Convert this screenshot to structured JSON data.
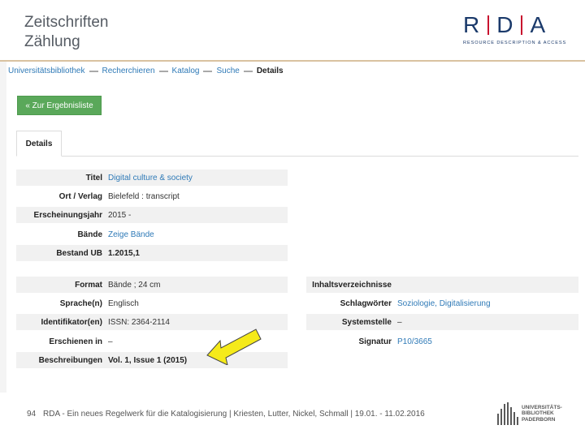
{
  "slide": {
    "title_line1": "Zeitschriften",
    "title_line2": "Zählung",
    "footer_page": "94",
    "footer_text": "RDA - Ein neues Regelwerk für die Katalogisierung | Kriesten, Lutter, Nickel, Schmall | 19.01. - 11.02.2016"
  },
  "rda_logo": {
    "letters": [
      "R",
      "D",
      "A"
    ],
    "tagline": "RESOURCE DESCRIPTION & ACCESS",
    "colors": {
      "letters": "#1b3a6b",
      "bars": "#c8102e"
    }
  },
  "ub_logo": {
    "line1": "UNIVERSITÄTS-",
    "line2": "BIBLIOTHEK",
    "line3": "PADERBORN"
  },
  "breadcrumb": {
    "items": [
      "Universitätsbibliothek",
      "Recherchieren",
      "Katalog",
      "Suche"
    ],
    "current": "Details"
  },
  "back_button": {
    "label": "« Zur Ergebnisliste",
    "color": "#5aa85a"
  },
  "tabs": [
    {
      "label": "Details",
      "active": true
    }
  ],
  "details_top": [
    {
      "label": "Titel",
      "value": "Digital culture & society",
      "style": "link"
    },
    {
      "label": "Ort / Verlag",
      "value": "Bielefeld : transcript",
      "style": "plain"
    },
    {
      "label": "Erscheinungsjahr",
      "value": "2015 -",
      "style": "plain"
    },
    {
      "label": "Bände",
      "value": "Zeige Bände",
      "style": "link"
    },
    {
      "label": "Bestand UB",
      "value": "1.2015,1",
      "style": "bold"
    }
  ],
  "details_left": [
    {
      "label": "Format",
      "value": "Bände ; 24 cm",
      "style": "plain"
    },
    {
      "label": "Sprache(n)",
      "value": "Englisch",
      "style": "plain"
    },
    {
      "label": "Identifikator(en)",
      "value": "ISSN: 2364-2114",
      "style": "plain"
    },
    {
      "label": "Erschienen in",
      "value": "–",
      "style": "plain"
    },
    {
      "label": "Beschreibungen",
      "value": "Vol. 1, Issue 1 (2015)",
      "style": "bold"
    }
  ],
  "details_right": [
    {
      "label": "Inhaltsverzeichnisse",
      "value": "",
      "style": "plain"
    },
    {
      "label": "Schlagwörter",
      "value": "Soziologie, Digitalisierung",
      "style": "link"
    },
    {
      "label": "Systemstelle",
      "value": "–",
      "style": "plain"
    },
    {
      "label": "Signatur",
      "value": "P10/3665",
      "style": "link"
    }
  ],
  "annotation": {
    "color": "#f5ea1a"
  }
}
